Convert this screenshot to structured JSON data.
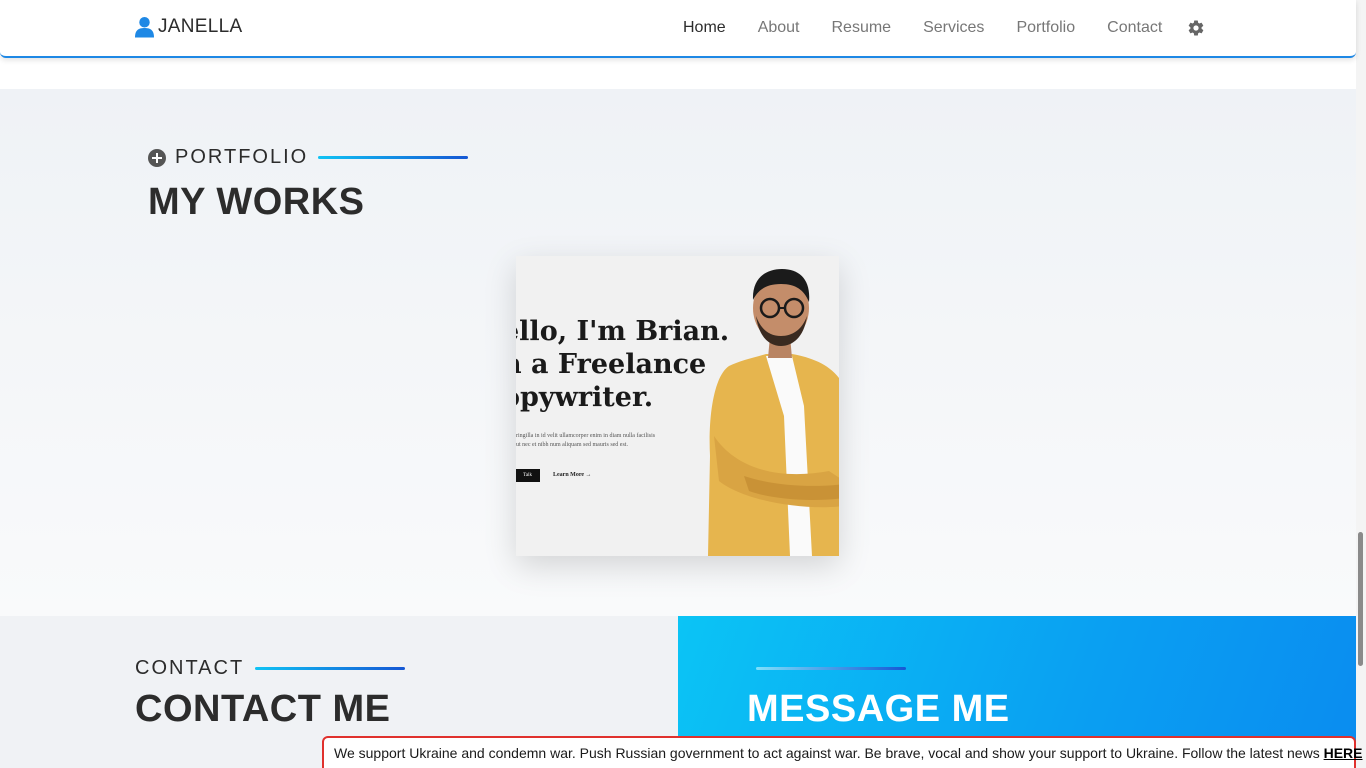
{
  "header": {
    "brand": "JANELLA",
    "nav": [
      "Home",
      "About",
      "Resume",
      "Services",
      "Portfolio",
      "Contact"
    ],
    "active": "Home",
    "accent_color": "#1e88e5"
  },
  "portfolio": {
    "sub_label": "PORTFOLIO",
    "title": "MY WORKS",
    "card": {
      "line1": "ello, I'm Brian.",
      "line2": "n a Freelance",
      "line3": "opywriter.",
      "small1": "ringilla in id velit ullamcorper enim in diam nulla facilisis",
      "small2": "ut nec et nibh num aliquam sed mauris sed est.",
      "btn": "Talk",
      "learn": "Learn More →"
    }
  },
  "contact": {
    "sub_label": "CONTACT",
    "title": "CONTACT ME",
    "message_title": "MESSAGE ME"
  },
  "banner": {
    "text": "We support Ukraine and condemn war. Push Russian government to act against war. Be brave, vocal and show your support to Ukraine. Follow the latest news ",
    "link": "HERE",
    "border_color": "#e0312d"
  },
  "icons": [
    "user-icon",
    "gear-icon",
    "plus-circle-icon"
  ]
}
